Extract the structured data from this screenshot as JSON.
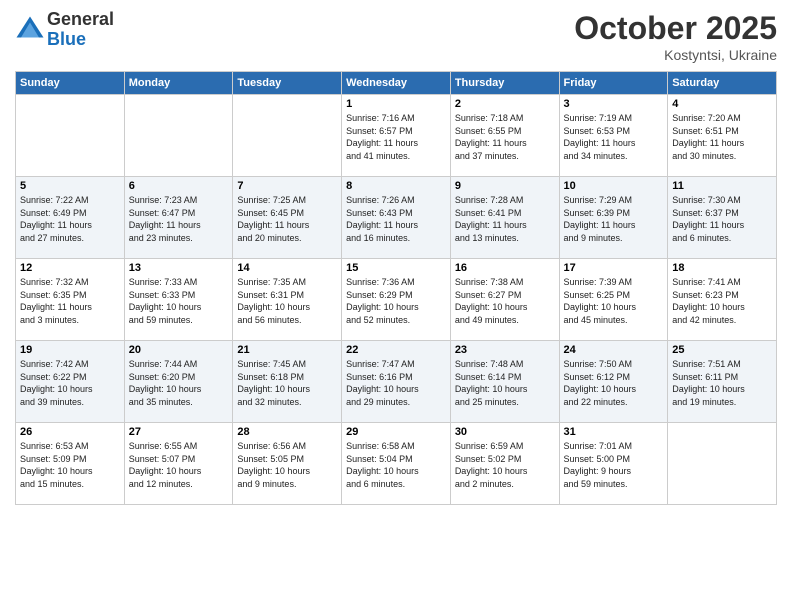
{
  "logo": {
    "general": "General",
    "blue": "Blue"
  },
  "header": {
    "month": "October 2025",
    "location": "Kostyntsi, Ukraine"
  },
  "weekdays": [
    "Sunday",
    "Monday",
    "Tuesday",
    "Wednesday",
    "Thursday",
    "Friday",
    "Saturday"
  ],
  "weeks": [
    [
      {
        "day": "",
        "info": ""
      },
      {
        "day": "",
        "info": ""
      },
      {
        "day": "",
        "info": ""
      },
      {
        "day": "1",
        "info": "Sunrise: 7:16 AM\nSunset: 6:57 PM\nDaylight: 11 hours\nand 41 minutes."
      },
      {
        "day": "2",
        "info": "Sunrise: 7:18 AM\nSunset: 6:55 PM\nDaylight: 11 hours\nand 37 minutes."
      },
      {
        "day": "3",
        "info": "Sunrise: 7:19 AM\nSunset: 6:53 PM\nDaylight: 11 hours\nand 34 minutes."
      },
      {
        "day": "4",
        "info": "Sunrise: 7:20 AM\nSunset: 6:51 PM\nDaylight: 11 hours\nand 30 minutes."
      }
    ],
    [
      {
        "day": "5",
        "info": "Sunrise: 7:22 AM\nSunset: 6:49 PM\nDaylight: 11 hours\nand 27 minutes."
      },
      {
        "day": "6",
        "info": "Sunrise: 7:23 AM\nSunset: 6:47 PM\nDaylight: 11 hours\nand 23 minutes."
      },
      {
        "day": "7",
        "info": "Sunrise: 7:25 AM\nSunset: 6:45 PM\nDaylight: 11 hours\nand 20 minutes."
      },
      {
        "day": "8",
        "info": "Sunrise: 7:26 AM\nSunset: 6:43 PM\nDaylight: 11 hours\nand 16 minutes."
      },
      {
        "day": "9",
        "info": "Sunrise: 7:28 AM\nSunset: 6:41 PM\nDaylight: 11 hours\nand 13 minutes."
      },
      {
        "day": "10",
        "info": "Sunrise: 7:29 AM\nSunset: 6:39 PM\nDaylight: 11 hours\nand 9 minutes."
      },
      {
        "day": "11",
        "info": "Sunrise: 7:30 AM\nSunset: 6:37 PM\nDaylight: 11 hours\nand 6 minutes."
      }
    ],
    [
      {
        "day": "12",
        "info": "Sunrise: 7:32 AM\nSunset: 6:35 PM\nDaylight: 11 hours\nand 3 minutes."
      },
      {
        "day": "13",
        "info": "Sunrise: 7:33 AM\nSunset: 6:33 PM\nDaylight: 10 hours\nand 59 minutes."
      },
      {
        "day": "14",
        "info": "Sunrise: 7:35 AM\nSunset: 6:31 PM\nDaylight: 10 hours\nand 56 minutes."
      },
      {
        "day": "15",
        "info": "Sunrise: 7:36 AM\nSunset: 6:29 PM\nDaylight: 10 hours\nand 52 minutes."
      },
      {
        "day": "16",
        "info": "Sunrise: 7:38 AM\nSunset: 6:27 PM\nDaylight: 10 hours\nand 49 minutes."
      },
      {
        "day": "17",
        "info": "Sunrise: 7:39 AM\nSunset: 6:25 PM\nDaylight: 10 hours\nand 45 minutes."
      },
      {
        "day": "18",
        "info": "Sunrise: 7:41 AM\nSunset: 6:23 PM\nDaylight: 10 hours\nand 42 minutes."
      }
    ],
    [
      {
        "day": "19",
        "info": "Sunrise: 7:42 AM\nSunset: 6:22 PM\nDaylight: 10 hours\nand 39 minutes."
      },
      {
        "day": "20",
        "info": "Sunrise: 7:44 AM\nSunset: 6:20 PM\nDaylight: 10 hours\nand 35 minutes."
      },
      {
        "day": "21",
        "info": "Sunrise: 7:45 AM\nSunset: 6:18 PM\nDaylight: 10 hours\nand 32 minutes."
      },
      {
        "day": "22",
        "info": "Sunrise: 7:47 AM\nSunset: 6:16 PM\nDaylight: 10 hours\nand 29 minutes."
      },
      {
        "day": "23",
        "info": "Sunrise: 7:48 AM\nSunset: 6:14 PM\nDaylight: 10 hours\nand 25 minutes."
      },
      {
        "day": "24",
        "info": "Sunrise: 7:50 AM\nSunset: 6:12 PM\nDaylight: 10 hours\nand 22 minutes."
      },
      {
        "day": "25",
        "info": "Sunrise: 7:51 AM\nSunset: 6:11 PM\nDaylight: 10 hours\nand 19 minutes."
      }
    ],
    [
      {
        "day": "26",
        "info": "Sunrise: 6:53 AM\nSunset: 5:09 PM\nDaylight: 10 hours\nand 15 minutes."
      },
      {
        "day": "27",
        "info": "Sunrise: 6:55 AM\nSunset: 5:07 PM\nDaylight: 10 hours\nand 12 minutes."
      },
      {
        "day": "28",
        "info": "Sunrise: 6:56 AM\nSunset: 5:05 PM\nDaylight: 10 hours\nand 9 minutes."
      },
      {
        "day": "29",
        "info": "Sunrise: 6:58 AM\nSunset: 5:04 PM\nDaylight: 10 hours\nand 6 minutes."
      },
      {
        "day": "30",
        "info": "Sunrise: 6:59 AM\nSunset: 5:02 PM\nDaylight: 10 hours\nand 2 minutes."
      },
      {
        "day": "31",
        "info": "Sunrise: 7:01 AM\nSunset: 5:00 PM\nDaylight: 9 hours\nand 59 minutes."
      },
      {
        "day": "",
        "info": ""
      }
    ]
  ]
}
